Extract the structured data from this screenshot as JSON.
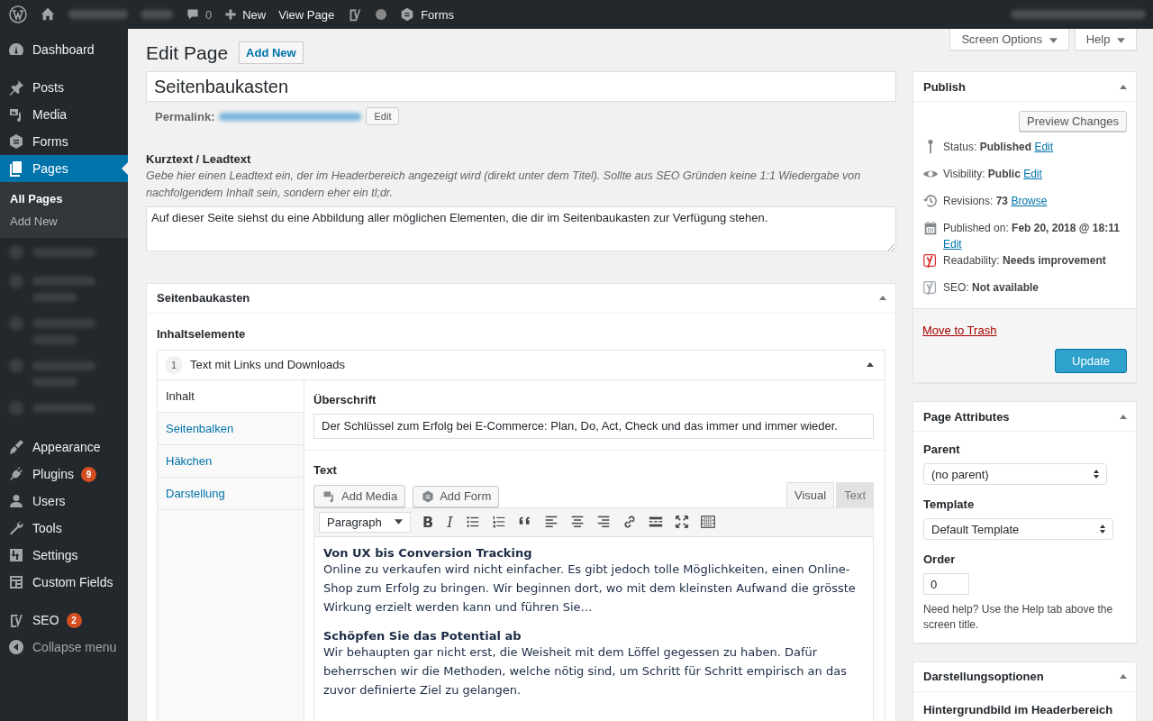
{
  "admin_bar": {
    "comments": "0",
    "new": "New",
    "view_page": "View Page",
    "forms": "Forms"
  },
  "screen_links": [
    {
      "label": "Screen Options"
    },
    {
      "label": "Help"
    }
  ],
  "sidebar": {
    "groups": [
      {
        "items": [
          {
            "label": "Dashboard",
            "kind": "dashboard",
            "selected": false
          }
        ]
      },
      {
        "items": [
          {
            "label": "Posts",
            "kind": "pin",
            "selected": false
          },
          {
            "label": "Media",
            "kind": "media",
            "selected": false
          },
          {
            "label": "Forms",
            "kind": "forms",
            "selected": false
          },
          {
            "label": "Pages",
            "kind": "pages",
            "selected": true,
            "submenu": [
              {
                "label": "All Pages",
                "selected": true
              },
              {
                "label": "Add New",
                "selected": false
              }
            ]
          },
          {
            "kind": "redacted"
          },
          {
            "kind": "redacted-tall"
          },
          {
            "kind": "redacted-tall"
          },
          {
            "kind": "redacted-tall"
          },
          {
            "kind": "redacted"
          }
        ]
      },
      {
        "items": [
          {
            "label": "Appearance",
            "kind": "brush",
            "selected": false
          },
          {
            "label": "Plugins",
            "kind": "plug",
            "selected": false,
            "badge": "9"
          },
          {
            "label": "Users",
            "kind": "user",
            "selected": false
          },
          {
            "label": "Tools",
            "kind": "wrench",
            "selected": false
          },
          {
            "label": "Settings",
            "kind": "sliders",
            "selected": false
          },
          {
            "label": "Custom Fields",
            "kind": "grid",
            "selected": false
          }
        ]
      },
      {
        "items": [
          {
            "label": "SEO",
            "kind": "yoast",
            "selected": false,
            "badge": "2"
          },
          {
            "label": "Collapse menu",
            "kind": "collapse",
            "selected": false
          }
        ]
      }
    ]
  },
  "heading": {
    "title": "Edit Page",
    "add_new": "Add New"
  },
  "post_title": "Seitenbaukasten",
  "permalink": {
    "label": "Permalink:",
    "edit": "Edit"
  },
  "lead": {
    "label": "Kurztext / Leadtext",
    "description": "Gebe hier einen Leadtext ein, der im Headerbereich angezeigt wird (direkt unter dem Titel). Sollte aus SEO Gründen keine 1:1 Wiedergabe von nachfolgendem Inhalt sein, sondern eher ein tl;dr.",
    "value": "Auf dieser Seite siehst du eine Abbildung aller möglichen Elementen, die dir im Seitenbaukasten zur Verfügung stehen."
  },
  "builder": {
    "title": "Seitenbaukasten",
    "subheading": "Inhaltselemente",
    "element": {
      "number": "1",
      "title": "Text mit Links und Downloads"
    },
    "tabs": [
      {
        "label": "Inhalt",
        "selected": true
      },
      {
        "label": "Seitenbalken",
        "selected": false
      },
      {
        "label": "Häkchen",
        "selected": false
      },
      {
        "label": "Darstellung",
        "selected": false
      }
    ],
    "heading_field": {
      "label": "Überschrift",
      "value": "Der Schlüssel zum Erfolg bei E-Commerce: Plan, Do, Act, Check und das immer und immer wieder."
    },
    "text_field": {
      "label": "Text",
      "buttons": [
        "Add Media",
        "Add Form"
      ],
      "modes": [
        {
          "label": "Visual",
          "selected": true
        },
        {
          "label": "Text",
          "selected": false
        }
      ],
      "format": "Paragraph",
      "toolbar": [
        {
          "kind": "bold",
          "label": "B"
        },
        {
          "kind": "italic",
          "label": "I"
        },
        {
          "kind": "bullet-list"
        },
        {
          "kind": "numbered-list"
        },
        {
          "kind": "quote"
        },
        {
          "kind": "align-left"
        },
        {
          "kind": "align-center"
        },
        {
          "kind": "align-right"
        },
        {
          "kind": "link"
        },
        {
          "kind": "more"
        },
        {
          "kind": "fullscreen"
        },
        {
          "kind": "kitchen-sink"
        }
      ],
      "content": [
        {
          "heading": "Von UX bis Conversion Tracking",
          "text": "Online zu verkaufen wird nicht einfacher. Es gibt jedoch tolle Möglichkeiten, einen Online-Shop zum Erfolg zu bringen. Wir beginnen dort, wo mit dem kleinsten Aufwand die grösste Wirkung erzielt werden kann und führen Sie…"
        },
        {
          "heading": "Schöpfen Sie das Potential ab",
          "text": "Wir behaupten gar nicht erst, die Weisheit mit dem Löffel gegessen zu haben. Dafür beherrschen wir die Methoden, welche nötig sind, um Schritt für Schritt empirisch an das zuvor definierte Ziel zu gelangen."
        }
      ]
    }
  },
  "publish": {
    "title": "Publish",
    "preview": "Preview Changes",
    "rows": [
      {
        "kind": "pin",
        "label": "Status:",
        "value": "Published",
        "link": "Edit"
      },
      {
        "kind": "eye",
        "label": "Visibility:",
        "value": "Public",
        "link": "Edit"
      },
      {
        "kind": "history",
        "label": "Revisions:",
        "value": "73",
        "link": "Browse"
      },
      {
        "kind": "calendar",
        "label": "Published on:",
        "value": "Feb 20, 2018 @ 18:11",
        "link": "Edit"
      },
      {
        "kind": "yoast",
        "label": "Readability:",
        "value": "Needs improvement",
        "color": "#dc3232"
      },
      {
        "kind": "yoast",
        "label": "SEO:",
        "value": "Not available",
        "color": "#a0a5aa"
      }
    ],
    "trash": "Move to Trash",
    "update": "Update"
  },
  "page_attributes": {
    "title": "Page Attributes",
    "parent_label": "Parent",
    "parent": "(no parent)",
    "template_label": "Template",
    "template": "Default Template",
    "order_label": "Order",
    "order": "0",
    "help": "Need help? Use the Help tab above the screen title."
  },
  "display_options": {
    "title": "Darstellungsoptionen",
    "subheading": "Hintergrundbild im Headerbereich"
  }
}
